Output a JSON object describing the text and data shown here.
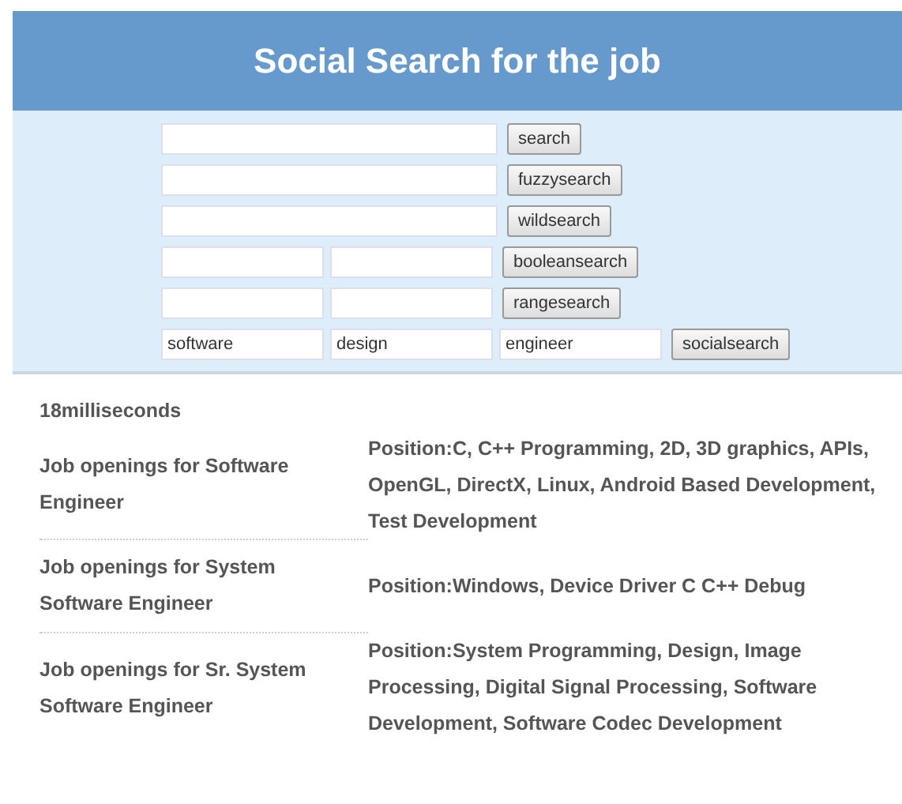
{
  "title": "Social Search for the job",
  "search_rows": [
    {
      "fields": [
        {
          "kind": "wide"
        }
      ],
      "button": "search"
    },
    {
      "fields": [
        {
          "kind": "wide"
        }
      ],
      "button": "fuzzysearch"
    },
    {
      "fields": [
        {
          "kind": "wide"
        }
      ],
      "button": "wildsearch"
    },
    {
      "fields": [
        {
          "kind": "narrow"
        },
        {
          "kind": "narrow"
        }
      ],
      "button": "booleansearch"
    },
    {
      "fields": [
        {
          "kind": "narrow"
        },
        {
          "kind": "narrow"
        }
      ],
      "button": "rangesearch"
    },
    {
      "fields": [
        {
          "kind": "narrow",
          "value": "software"
        },
        {
          "kind": "narrow",
          "value": "design"
        },
        {
          "kind": "narrow",
          "value": "engineer"
        }
      ],
      "button": "socialsearch"
    }
  ],
  "timing": "18milliseconds",
  "results": [
    {
      "title": "Job openings for Software Engineer",
      "position": "Position:C, C++ Programming, 2D, 3D graphics, APIs, OpenGL, DirectX, Linux, Android Based Development, Test Development"
    },
    {
      "title": "Job openings for System Software Engineer",
      "position": "Position:Windows, Device Driver C C++ Debug"
    },
    {
      "title": "Job openings for Sr. System Software Engineer",
      "position": "Position:System Programming, Design, Image Processing, Digital Signal Processing, Software Development, Software Codec Development"
    }
  ]
}
